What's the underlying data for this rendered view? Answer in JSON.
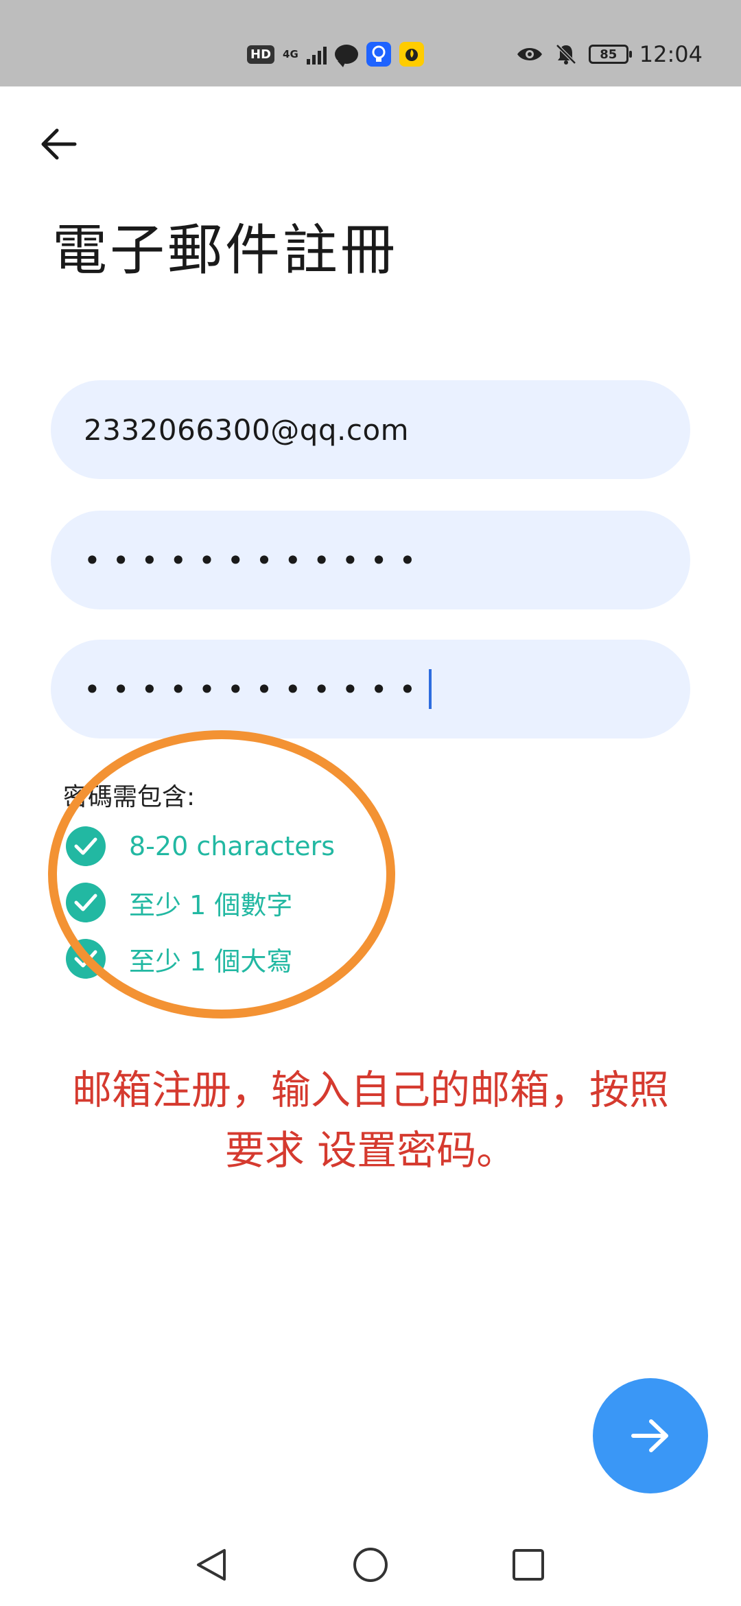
{
  "status_bar": {
    "hd": "HD",
    "network": "4G",
    "battery": "85",
    "time": "12:04"
  },
  "header": {
    "title": "電子郵件註冊"
  },
  "form": {
    "email_value": "2332066300@qq.com",
    "password_mask": "••••••••••••",
    "confirm_mask": "••••••••••••"
  },
  "requirements": {
    "heading": "密碼需包含:",
    "items": [
      "8-20 characters",
      "至少 1 個數字",
      "至少 1 個大寫"
    ]
  },
  "annotation": {
    "line1": "邮箱注册，输入自己的邮箱，按照",
    "line2": "要求 设置密码。"
  },
  "colors": {
    "accent_blue": "#3a97f6",
    "check_teal": "#22b8a2",
    "annotation_red": "#d53a2f",
    "circle_orange": "#f39233",
    "field_bg": "#eaf1ff"
  }
}
